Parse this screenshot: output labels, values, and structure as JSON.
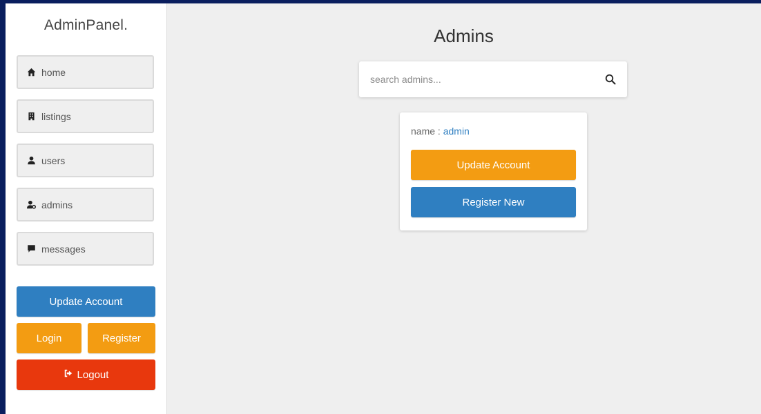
{
  "sidebar": {
    "logo": "AdminPanel.",
    "nav": [
      {
        "label": "home",
        "icon": "home-icon"
      },
      {
        "label": "listings",
        "icon": "building-icon"
      },
      {
        "label": "users",
        "icon": "user-icon"
      },
      {
        "label": "admins",
        "icon": "user-gear-icon"
      },
      {
        "label": "messages",
        "icon": "message-icon"
      }
    ],
    "update_account": "Update Account",
    "login": "Login",
    "register": "Register",
    "logout": "Logout"
  },
  "main": {
    "title": "Admins",
    "search": {
      "placeholder": "search admins...",
      "value": ""
    },
    "card": {
      "name_label": "name : ",
      "name_value": "admin",
      "update_account": "Update Account",
      "register_new": "Register New"
    }
  },
  "colors": {
    "blue": "#2f7fc1",
    "orange": "#f39c12",
    "red": "#e8380d",
    "background": "#efefef"
  }
}
